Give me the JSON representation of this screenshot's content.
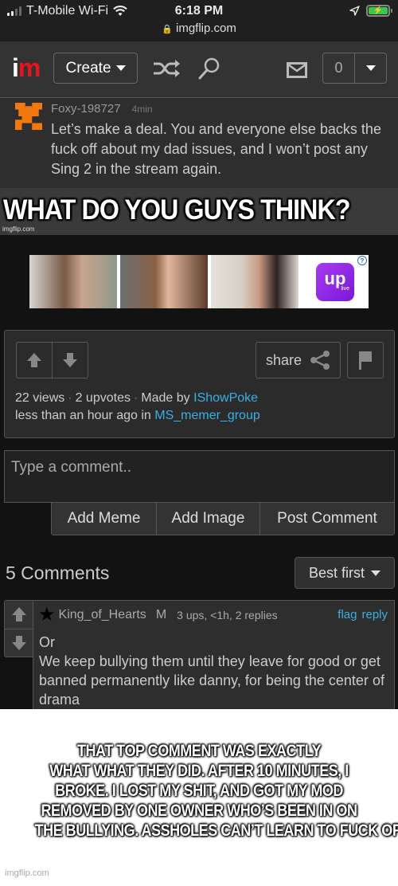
{
  "status_bar": {
    "carrier": "T-Mobile Wi-Fi",
    "time": "6:18 PM",
    "url": "imgflip.com",
    "battery_charging": true,
    "battery_color": "#3ac84a"
  },
  "nav": {
    "logo_i": "i",
    "logo_m": "m",
    "logo_accent": "#e8141c",
    "create_label": "Create",
    "notification_count": "0"
  },
  "meme": {
    "embedded_comment": {
      "username": "Foxy-198727",
      "time": "4min",
      "text": "Let’s make a deal. You and everyone else backs the fuck off about my dad issues, and I won’t post any Sing 2 in the stream again."
    },
    "caption": "WHAT DO YOU GUYS THINK?",
    "watermark": "imgflip.com"
  },
  "ad": {
    "brand": "up",
    "brand_sub": "live",
    "help_label": "?"
  },
  "post_info": {
    "share_label": "share",
    "views": "22 views",
    "upvotes": "2 upvotes",
    "made_by_label": "Made by",
    "author": "IShowPoke",
    "time_text": "less than an hour ago in",
    "stream": "MS_memer_group",
    "separator": "·"
  },
  "comment_form": {
    "placeholder": "Type a comment..",
    "add_meme": "Add Meme",
    "add_image": "Add Image",
    "post_comment": "Post Comment"
  },
  "comments": {
    "count_label": "5 Comments",
    "sort_label": "Best first",
    "items": [
      {
        "star": "★",
        "username": "King_of_Hearts",
        "badge": "M",
        "meta": "3 ups, <1h, 2 replies",
        "flag_label": "flag",
        "reply_label": "reply",
        "line1": "Or",
        "line2": "We keep bullying them until they leave for good or get banned permanently like danny, for being the center of drama"
      }
    ]
  },
  "bottom_caption": {
    "lines": [
      "THAT TOP COMMENT WAS EXACTLY",
      "WHAT WHAT THEY DID. AFTER 10 MINUTES, I",
      "BROKE. I LOST MY SHIT, AND GOT MY MOD",
      "REMOVED BY ONE OWNER WHO’S BEEN IN ON",
      "THE BULLYING. ASSHOLES CAN’T LEARN TO FUCK OFF."
    ],
    "watermark": "imgflip.com"
  }
}
